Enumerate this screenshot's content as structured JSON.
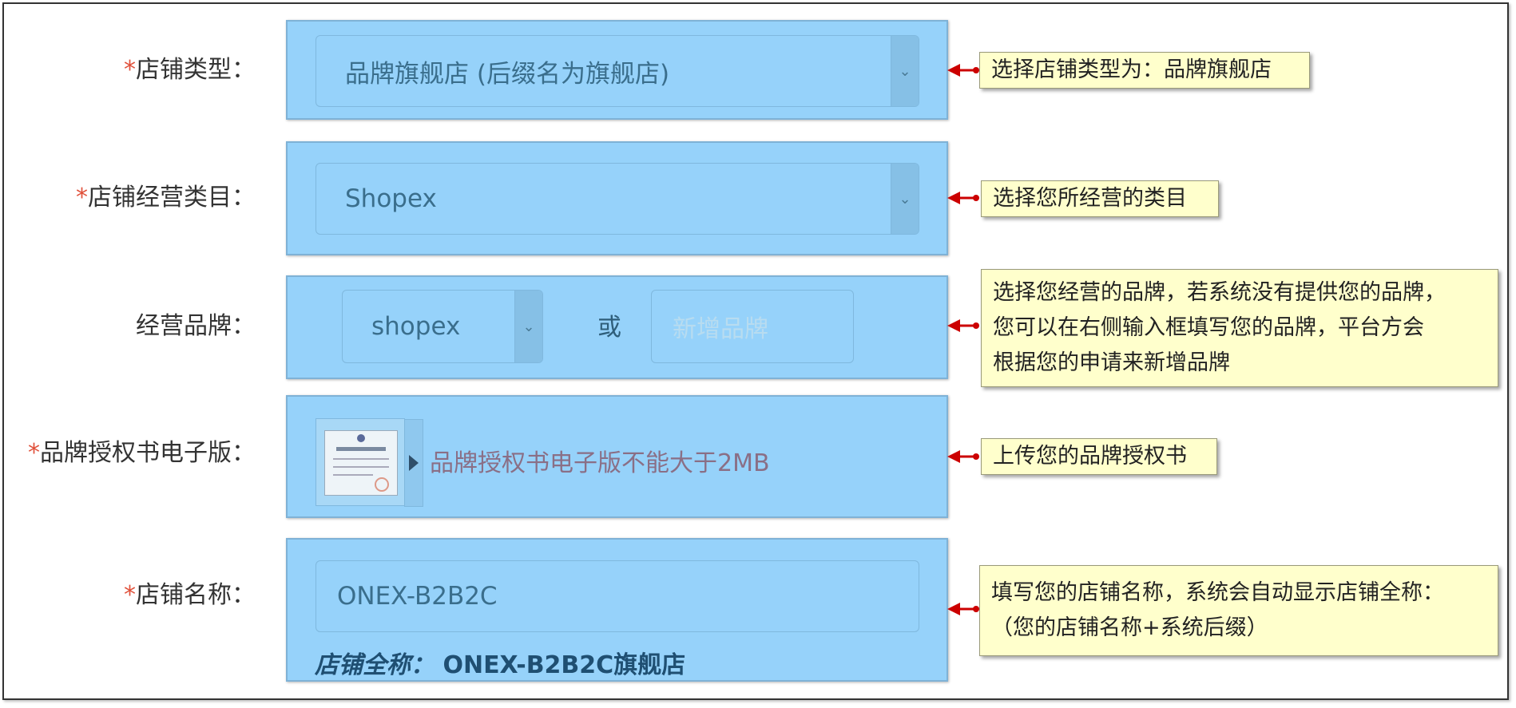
{
  "required_mark": "*",
  "colon": "：",
  "rows": [
    {
      "label": "店铺类型",
      "required": true,
      "value": "品牌旗舰店 (后缀名为旗舰店)",
      "callout": "选择店铺类型为：品牌旗舰店"
    },
    {
      "label": "店铺经营类目",
      "required": true,
      "value": "Shopex",
      "callout": "选择您所经营的类目"
    },
    {
      "label": "经营品牌",
      "required": false,
      "value": "shopex",
      "or_text": "或",
      "new_brand_placeholder": "新增品牌",
      "callout_lines": [
        "选择您经营的品牌，若系统没有提供您的品牌，",
        "您可以在右侧输入框填写您的品牌，平台方会",
        "根据您的申请来新增品牌"
      ]
    },
    {
      "label": "品牌授权书电子版",
      "required": true,
      "upload_hint": "品牌授权书电子版不能大于2MB",
      "callout": "上传您的品牌授权书"
    },
    {
      "label": "店铺名称",
      "required": true,
      "value": "ONEX-B2B2C",
      "full_name_label": "店铺全称：",
      "full_name_value": "ONEX-B2B2C旗舰店",
      "callout_lines": [
        "填写您的店铺名称，系统会自动显示店铺全称：",
        "（您的店铺名称+系统后缀）"
      ]
    }
  ],
  "colors": {
    "panel": "#96d2fa",
    "callout": "#ffffcc",
    "arrow": "#cc0000",
    "required": "#e0503a"
  }
}
